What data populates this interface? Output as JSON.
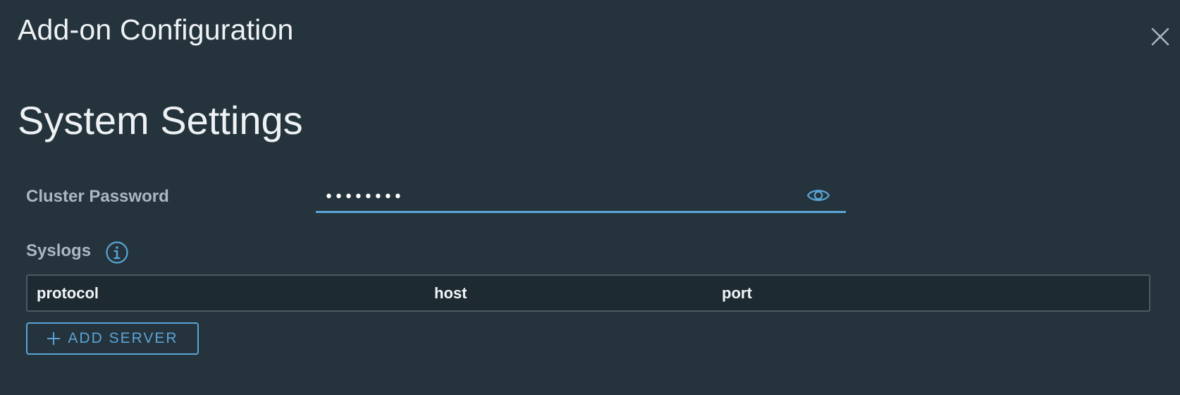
{
  "modal": {
    "title": "Add-on Configuration",
    "close_icon": "close-icon"
  },
  "section": {
    "title": "System Settings"
  },
  "cluster_password": {
    "label": "Cluster Password",
    "value": "••••••••",
    "toggle_icon": "eye-icon"
  },
  "syslogs": {
    "label": "Syslogs",
    "info_icon": "info-icon",
    "columns": [
      "protocol",
      "host",
      "port"
    ],
    "rows": []
  },
  "add_server": {
    "label": "ADD SERVER",
    "icon": "plus-icon"
  },
  "colors": {
    "background": "#25333d",
    "accent": "#5aa5d6",
    "label": "#a9b8c1",
    "table_header_bg": "#1e2a32"
  }
}
